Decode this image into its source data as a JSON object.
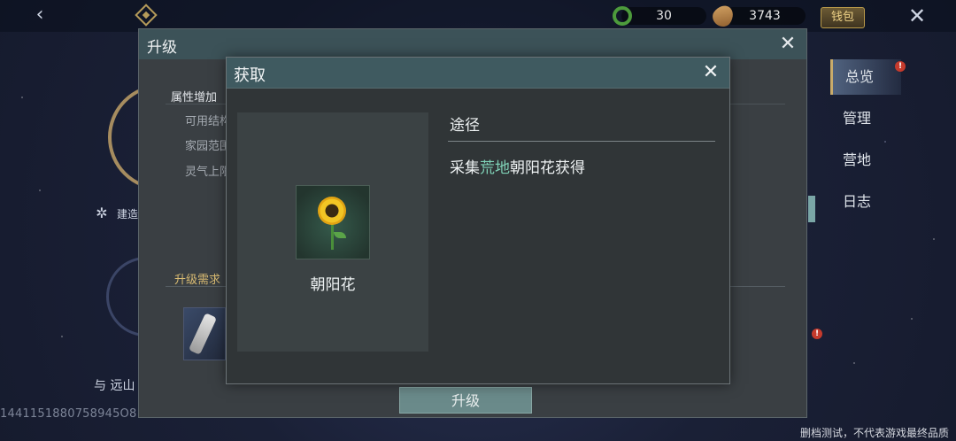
{
  "topbar": {
    "jade_amount": "30",
    "seed_amount": "3743",
    "wallet_label": "钱包"
  },
  "background": {
    "build_text": "建造",
    "caption": "与 远山",
    "id_text": "1441151880758945O8",
    "watermark": "删档测试，不代表游戏最终品质"
  },
  "tabs": [
    {
      "label": "总览",
      "active": true,
      "alert": true
    },
    {
      "label": "管理",
      "active": false,
      "alert": false
    },
    {
      "label": "营地",
      "active": false,
      "alert": false
    },
    {
      "label": "日志",
      "active": false,
      "alert": false
    }
  ],
  "upgrade_window": {
    "title": "升级",
    "attr_title": "属性增加",
    "attr_rows": [
      "可用结构",
      "家园范围",
      "灵气上限"
    ],
    "req_title": "升级需求",
    "button": "升级"
  },
  "acquire_dialog": {
    "title": "获取",
    "item_name": "朝阳花",
    "route_title": "途径",
    "route_prefix": "采集",
    "route_highlight": "荒地",
    "route_suffix": "朝阳花获得"
  },
  "colors": {
    "accent_gold": "#c9ab6a",
    "highlight_green": "#7fd1b6",
    "alert_red": "#c53a2c"
  }
}
